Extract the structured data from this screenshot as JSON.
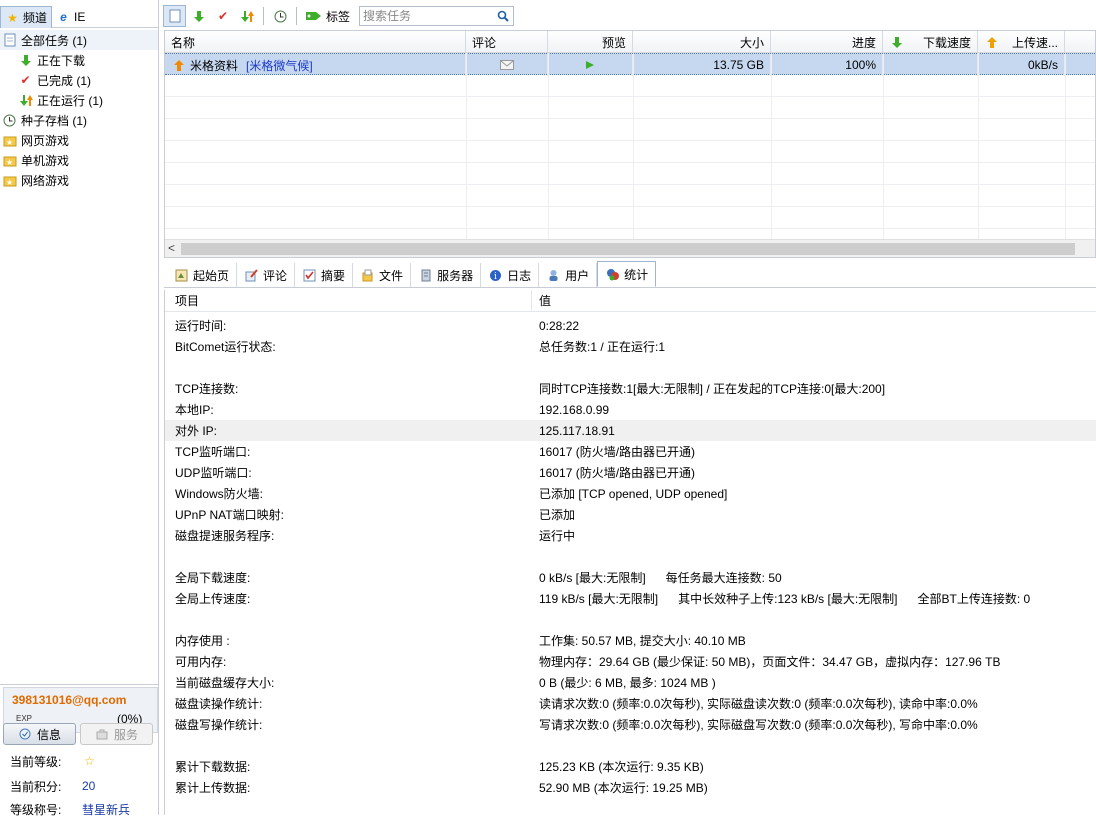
{
  "left_tabs": [
    {
      "label": "频道",
      "icon": "star-icon"
    },
    {
      "label": "IE",
      "icon": "ie-icon"
    }
  ],
  "tree": [
    {
      "label": "全部任务 (1)",
      "icon": "document-icon",
      "indent": 0
    },
    {
      "label": "正在下载",
      "icon": "green-down-arrow-icon",
      "indent": 1
    },
    {
      "label": "已完成 (1)",
      "icon": "red-check-icon",
      "indent": 1
    },
    {
      "label": "正在运行 (1)",
      "icon": "up-down-arrows-icon",
      "indent": 1
    },
    {
      "label": "种子存档 (1)",
      "icon": "clock-icon",
      "indent": 0
    },
    {
      "label": "网页游戏",
      "icon": "folder-star-icon",
      "indent": 0
    },
    {
      "label": "单机游戏",
      "icon": "folder-star-icon",
      "indent": 0
    },
    {
      "label": "网络游戏",
      "icon": "folder-star-icon",
      "indent": 0
    }
  ],
  "account": {
    "email": "398131016@qq.com",
    "exp_label": "EXP",
    "exp_value": "(0%)",
    "btn_info": "信息",
    "btn_service": "服务",
    "level_label": "当前等级:",
    "points_label": "当前积分:",
    "points_value": "20",
    "title_label": "等级称号:",
    "title_value": "彗星新兵"
  },
  "toolbar": {
    "tag_label": "标签",
    "search_placeholder": "搜索任务"
  },
  "grid": {
    "headers": {
      "name": "名称",
      "comment": "评论",
      "preview": "预览",
      "size": "大小",
      "progress": "进度",
      "down": "下载速度",
      "up": "上传速..."
    },
    "rows": [
      {
        "name": "米格资料",
        "tag": "[米格微气候]",
        "size": "13.75 GB",
        "progress": "100%",
        "up": "0kB/s"
      }
    ]
  },
  "bottom_tabs": [
    {
      "label": "起始页",
      "icon": "home-icon"
    },
    {
      "label": "评论",
      "icon": "comment-icon"
    },
    {
      "label": "摘要",
      "icon": "summary-icon"
    },
    {
      "label": "文件",
      "icon": "file-icon"
    },
    {
      "label": "服务器",
      "icon": "server-icon"
    },
    {
      "label": "日志",
      "icon": "info-icon"
    },
    {
      "label": "用户",
      "icon": "user-icon"
    },
    {
      "label": "统计",
      "icon": "stats-icon"
    }
  ],
  "stats": {
    "col_item": "项目",
    "col_value": "值",
    "rows": [
      {
        "k": "运行时间:",
        "v": "0:28:22"
      },
      {
        "k": "BitComet运行状态:",
        "v": "总任务数:1 / 正在运行:1"
      },
      {
        "k": "",
        "v": ""
      },
      {
        "k": "TCP连接数:",
        "v": "同时TCP连接数:1[最大:无限制] / 正在发起的TCP连接:0[最大:200]"
      },
      {
        "k": "本地IP:",
        "v": "192.168.0.99"
      },
      {
        "k": "对外 IP:",
        "v": "125.117.18.91"
      },
      {
        "k": "TCP监听端口:",
        "v": "16017 (防火墙/路由器已开通)"
      },
      {
        "k": "UDP监听端口:",
        "v": "16017 (防火墙/路由器已开通)"
      },
      {
        "k": "Windows防火墙:",
        "v": "已添加 [TCP opened, UDP opened]"
      },
      {
        "k": "UPnP NAT端口映射:",
        "v": "已添加"
      },
      {
        "k": "磁盘提速服务程序:",
        "v": "运行中"
      },
      {
        "k": "",
        "v": ""
      },
      {
        "k": "全局下载速度:",
        "v": "0 kB/s [最大:无限制]      每任务最大连接数: 50"
      },
      {
        "k": "全局上传速度:",
        "v": "119 kB/s [最大:无限制]      其中长效种子上传:123 kB/s [最大:无限制]      全部BT上传连接数: 0"
      },
      {
        "k": "",
        "v": ""
      },
      {
        "k": "内存使用 :",
        "v": "工作集: 50.57 MB, 提交大小: 40.10 MB"
      },
      {
        "k": "可用内存:",
        "v": "物理内存：29.64 GB (最少保证: 50 MB)，页面文件：34.47 GB，虚拟内存：127.96 TB"
      },
      {
        "k": "当前磁盘缓存大小:",
        "v": "0 B (最少: 6 MB, 最多: 1024 MB )"
      },
      {
        "k": "磁盘读操作统计:",
        "v": "读请求次数:0 (频率:0.0次每秒), 实际磁盘读次数:0 (频率:0.0次每秒), 读命中率:0.0%"
      },
      {
        "k": "磁盘写操作统计:",
        "v": "写请求次数:0 (频率:0.0次每秒), 实际磁盘写次数:0 (频率:0.0次每秒), 写命中率:0.0%"
      },
      {
        "k": "",
        "v": ""
      },
      {
        "k": "累计下载数据:",
        "v": "125.23 KB (本次运行: 9.35 KB)"
      },
      {
        "k": "累计上传数据:",
        "v": "52.90 MB (本次运行: 19.25 MB)"
      }
    ]
  }
}
